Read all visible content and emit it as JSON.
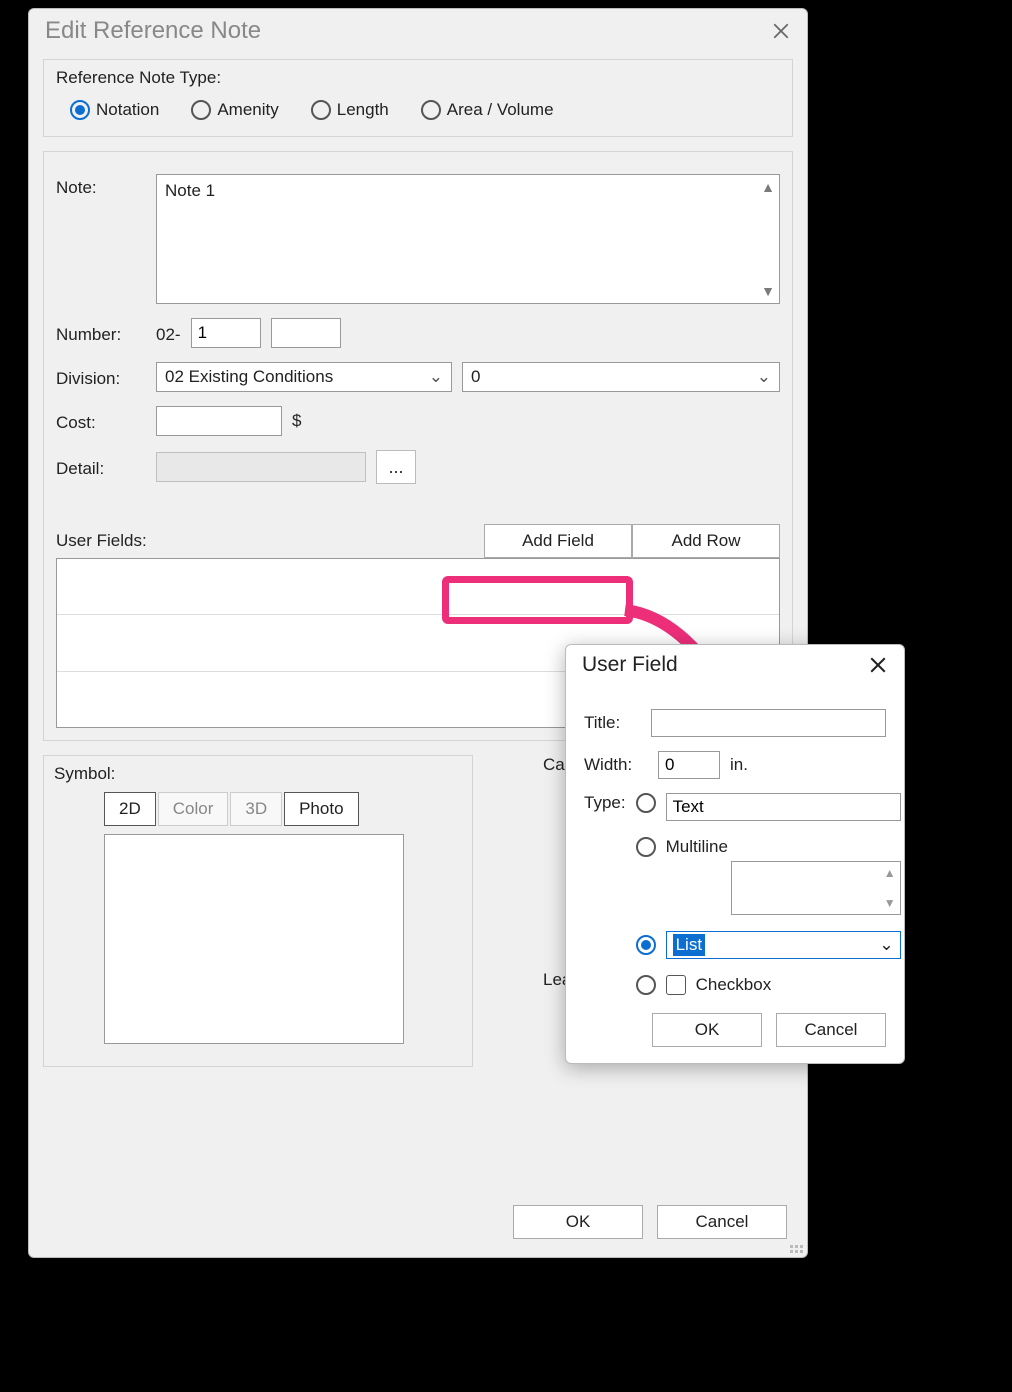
{
  "main": {
    "title": "Edit Reference Note",
    "refTypeLabel": "Reference Note Type:",
    "refTypes": {
      "notation": "Notation",
      "amenity": "Amenity",
      "length": "Length",
      "area": "Area / Volume"
    },
    "noteLabel": "Note:",
    "noteValue": "Note 1",
    "numberLabel": "Number:",
    "numberPrefix": "02-",
    "numberValue": "1",
    "divisionLabel": "Division:",
    "divisionValue": "02  Existing Conditions",
    "divisionNum": "0",
    "costLabel": "Cost:",
    "costCurrency": "$",
    "detailLabel": "Detail:",
    "browse": "...",
    "userFieldsLabel": "User Fields:",
    "addField": "Add Field",
    "addRow": "Add Row",
    "symbolLabel": "Symbol:",
    "tabs": {
      "d2": "2D",
      "color": "Color",
      "d3": "3D",
      "photo": "Photo"
    },
    "calloutLabel": "Callout:",
    "leaderLabel": "Leader:",
    "ok": "OK",
    "cancel": "Cancel"
  },
  "sub": {
    "title": "User Field",
    "titleLabel": "Title:",
    "widthLabel": "Width:",
    "widthValue": "0",
    "widthUnit": "in.",
    "typeLabel": "Type:",
    "typeText": "Text",
    "typeMultiline": "Multiline",
    "typeList": "List",
    "typeCheckbox": "Checkbox",
    "ok": "OK",
    "cancel": "Cancel"
  }
}
